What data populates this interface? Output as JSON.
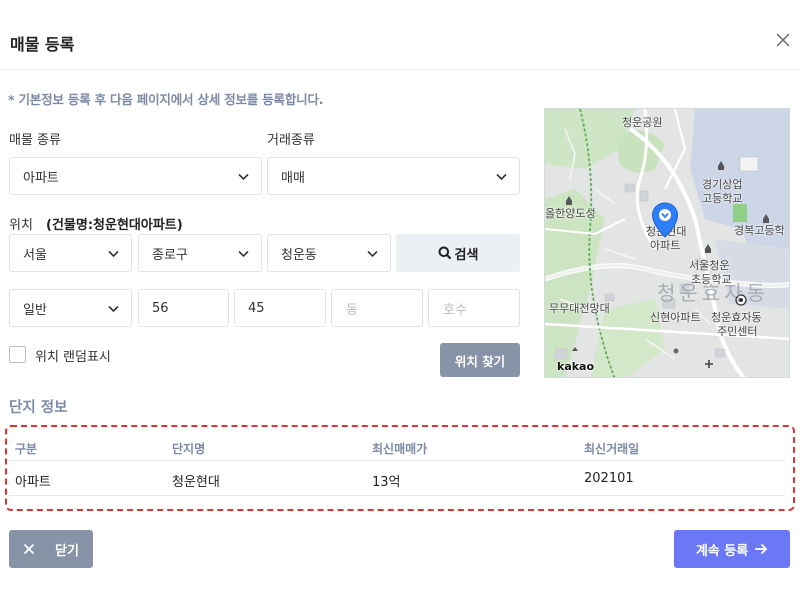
{
  "modal": {
    "title": "매물 등록",
    "notice": "* 기본정보 등록 후 다음 페이지에서 상세 정보를 등록합니다."
  },
  "form": {
    "property_type_label": "매물 종류",
    "property_type_value": "아파트",
    "deal_type_label": "거래종류",
    "deal_type_value": "매매",
    "location_label": "위치",
    "location_building": "(건물명:청운현대아파트)",
    "city": "서울",
    "district": "종로구",
    "dong": "청운동",
    "search_label": "검색",
    "lot_type": "일반",
    "main_number": "56",
    "sub_number": "45",
    "building_placeholder": "동",
    "unit_placeholder": "호수",
    "random_location_label": "위치 랜덤표시",
    "find_location_label": "위치 찾기"
  },
  "map": {
    "labels": [
      "청운공원",
      "경기상업",
      "고등학교",
      "경복고등학",
      "올한양도성",
      "청운현대",
      "아파트",
      "서울청운",
      "초등학교",
      "청운효자동",
      "무무대전망대",
      "신현아파트",
      "청운효자동",
      "주민센터",
      "kakao"
    ]
  },
  "complex": {
    "section_title": "단지 정보",
    "columns": [
      "구분",
      "단지명",
      "최신매매가",
      "최신거래일"
    ],
    "row": [
      "아파트",
      "청운현대",
      "13억",
      "202101"
    ]
  },
  "footer": {
    "close_label": "닫기",
    "next_label": "계속 등록"
  },
  "colors": {
    "accent": "#6b78f5",
    "secondary_button": "#8793a7",
    "label_muted": "#7d8aa6",
    "highlight_border": "#e03434",
    "map_pin": "#2d7ef7"
  }
}
